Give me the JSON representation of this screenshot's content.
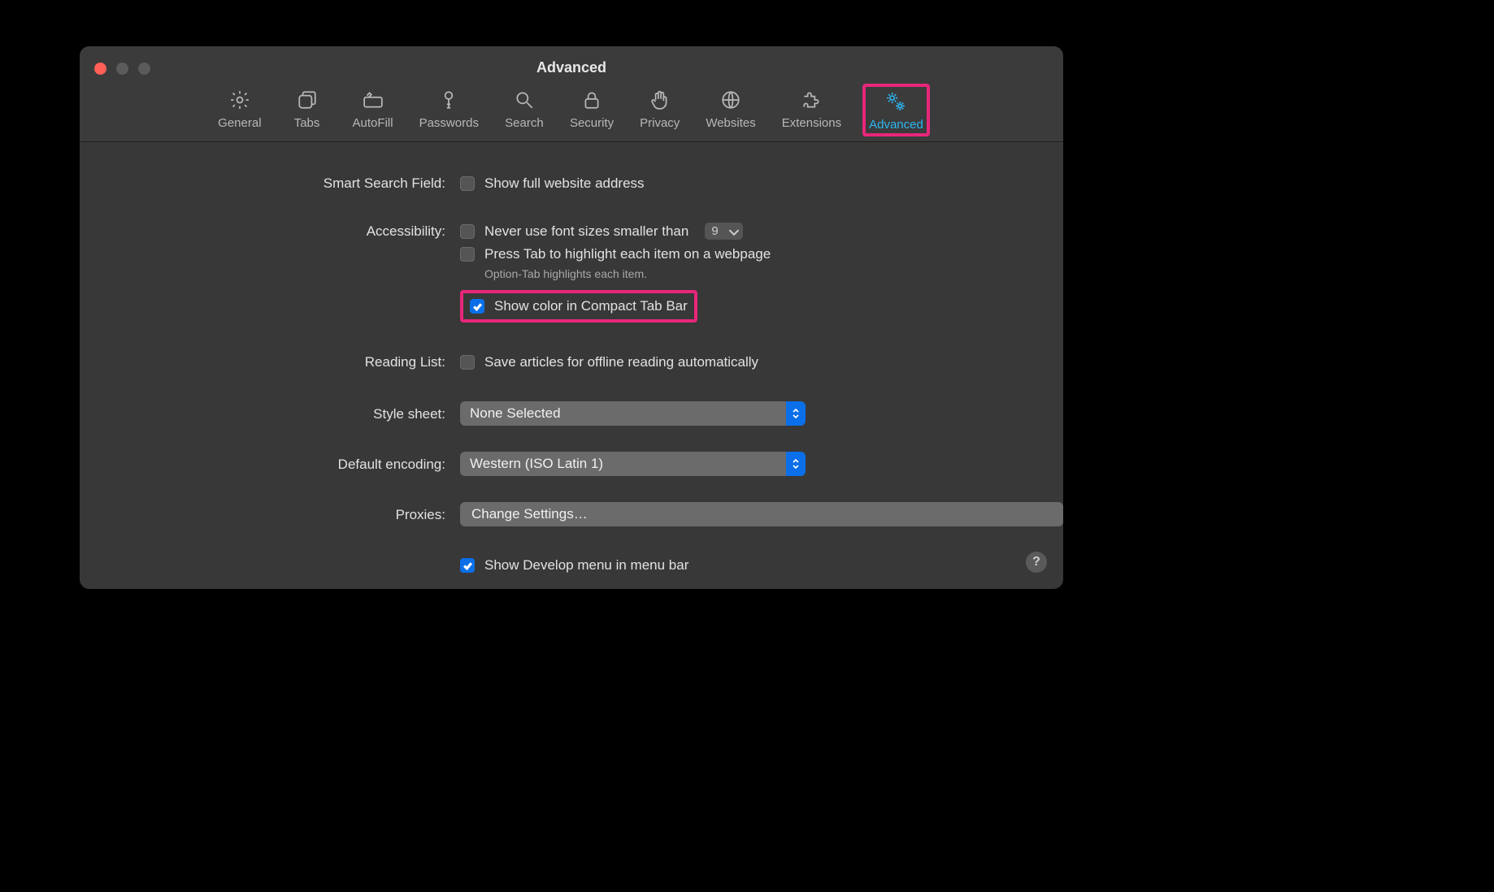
{
  "window": {
    "title": "Advanced"
  },
  "toolbar": {
    "items": [
      {
        "id": "general",
        "label": "General",
        "icon": "gear"
      },
      {
        "id": "tabs",
        "label": "Tabs",
        "icon": "tabs"
      },
      {
        "id": "autofill",
        "label": "AutoFill",
        "icon": "pencil-box"
      },
      {
        "id": "passwords",
        "label": "Passwords",
        "icon": "key"
      },
      {
        "id": "search",
        "label": "Search",
        "icon": "magnify"
      },
      {
        "id": "security",
        "label": "Security",
        "icon": "lock"
      },
      {
        "id": "privacy",
        "label": "Privacy",
        "icon": "hand"
      },
      {
        "id": "websites",
        "label": "Websites",
        "icon": "globe"
      },
      {
        "id": "extensions",
        "label": "Extensions",
        "icon": "puzzle"
      },
      {
        "id": "advanced",
        "label": "Advanced",
        "icon": "gears",
        "active": true
      }
    ]
  },
  "labels": {
    "smart_search": "Smart Search Field:",
    "accessibility": "Accessibility:",
    "reading_list": "Reading List:",
    "style_sheet": "Style sheet:",
    "default_encoding": "Default encoding:",
    "proxies": "Proxies:"
  },
  "options": {
    "show_full_address": "Show full website address",
    "never_font_smaller": "Never use font sizes smaller than",
    "font_min_value": "9",
    "press_tab": "Press Tab to highlight each item on a webpage",
    "option_tab_hint": "Option-Tab highlights each item.",
    "show_color_compact": "Show color in Compact Tab Bar",
    "save_offline": "Save articles for offline reading automatically",
    "show_develop": "Show Develop menu in menu bar"
  },
  "selects": {
    "style_sheet": "None Selected",
    "default_encoding": "Western (ISO Latin 1)"
  },
  "buttons": {
    "change_settings": "Change Settings…"
  },
  "help": "?"
}
